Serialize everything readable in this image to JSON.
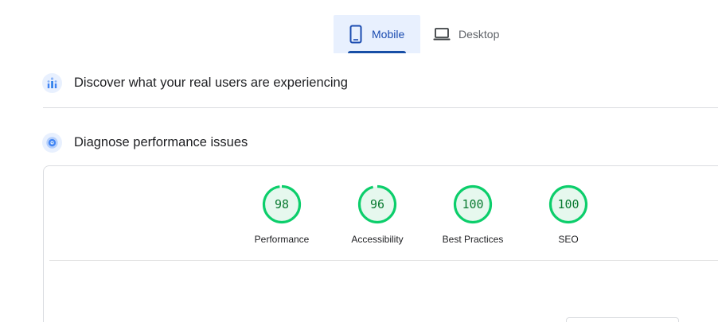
{
  "tabs": [
    {
      "label": "Mobile",
      "icon": "smartphone-icon",
      "selected": true
    },
    {
      "label": "Desktop",
      "icon": "laptop-icon",
      "selected": false
    }
  ],
  "sections": [
    {
      "title": "Discover what your real users are experiencing",
      "icon": "users-chart-icon"
    },
    {
      "title": "Diagnose performance issues",
      "icon": "target-icon"
    }
  ],
  "scores": [
    {
      "label": "Performance",
      "value": "98"
    },
    {
      "label": "Accessibility",
      "value": "96"
    },
    {
      "label": "Best Practices",
      "value": "100"
    },
    {
      "label": "SEO",
      "value": "100"
    }
  ],
  "colors": {
    "accent": "#1a4bb0",
    "tab_selected_bg": "#e8f0fe",
    "score_pass": "#0cce6b",
    "score_text": "#0a7a31",
    "ring_track": "#e6f8ee"
  }
}
